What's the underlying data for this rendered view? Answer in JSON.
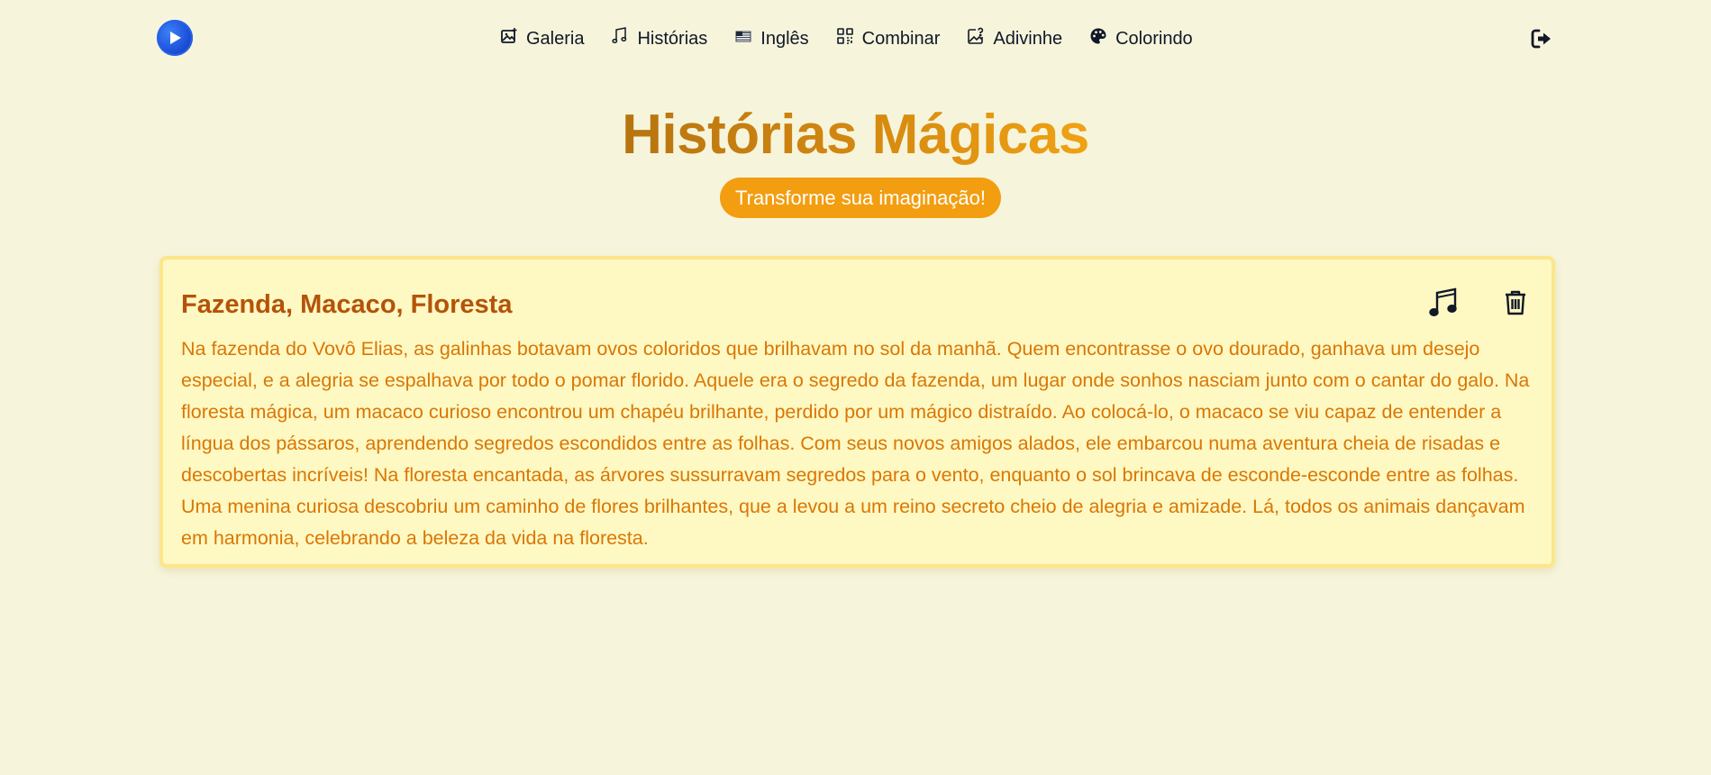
{
  "nav": {
    "items": [
      {
        "label": "Galeria",
        "icon": "image-sparkle-icon"
      },
      {
        "label": "Histórias",
        "icon": "music-notes-icon"
      },
      {
        "label": "Inglês",
        "icon": "us-flag-icon"
      },
      {
        "label": "Combinar",
        "icon": "qrcode-icon"
      },
      {
        "label": "Adivinhe",
        "icon": "image-question-icon"
      },
      {
        "label": "Colorindo",
        "icon": "palette-icon"
      }
    ],
    "logo_icon": "play-logo-icon",
    "logout_icon": "sign-out-icon"
  },
  "hero": {
    "title": "Histórias Mágicas",
    "badge": "Transforme sua imaginação!"
  },
  "stories": [
    {
      "title": "Fazenda, Macaco, Floresta",
      "text": "Na fazenda do Vovô Elias, as galinhas botavam ovos coloridos que brilhavam no sol da manhã. Quem encontrasse o ovo dourado, ganhava um desejo especial, e a alegria se espalhava por todo o pomar florido. Aquele era o segredo da fazenda, um lugar onde sonhos nasciam junto com o cantar do galo. Na floresta mágica, um macaco curioso encontrou um chapéu brilhante, perdido por um mágico distraído. Ao colocá-lo, o macaco se viu capaz de entender a língua dos pássaros, aprendendo segredos escondidos entre as folhas. Com seus novos amigos alados, ele embarcou numa aventura cheia de risadas e descobertas incríveis! Na floresta encantada, as árvores sussurravam segredos para o vento, enquanto o sol brincava de esconde-esconde entre as folhas. Uma menina curiosa descobriu um caminho de flores brilhantes, que a levou a um reino secreto cheio de alegria e amizade. Lá, todos os animais dançavam em harmonia, celebrando a beleza da vida na floresta.",
      "actions": [
        "music-notes-icon",
        "trash-icon"
      ]
    }
  ],
  "colors": {
    "background": "#f6f5dc",
    "accent": "#f29e10",
    "card_bg": "#fef8c2",
    "card_border": "#fde68a",
    "title": "#b45309",
    "text": "#d97706"
  }
}
